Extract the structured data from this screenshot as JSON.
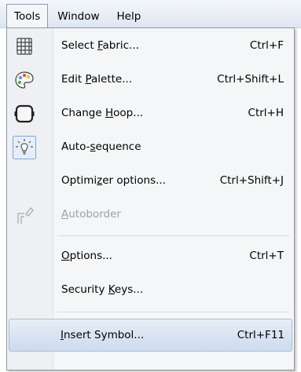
{
  "menubar": {
    "items": [
      {
        "label": "Tools"
      },
      {
        "label": "Window"
      },
      {
        "label": "Help"
      }
    ]
  },
  "menu": {
    "items": [
      {
        "pre": "Select ",
        "mn": "F",
        "post": "abric...",
        "shortcut": "Ctrl+F",
        "icon": "fabric-grid-icon"
      },
      {
        "pre": "Edit ",
        "mn": "P",
        "post": "alette...",
        "shortcut": "Ctrl+Shift+L",
        "icon": "palette-icon"
      },
      {
        "pre": "Change ",
        "mn": "H",
        "post": "oop...",
        "shortcut": "Ctrl+H",
        "icon": "hoop-icon"
      },
      {
        "pre": "Auto-",
        "mn": "s",
        "post": "equence",
        "shortcut": "",
        "icon": "auto-sequence-icon"
      },
      {
        "pre": "Optimi",
        "mn": "z",
        "post": "er options...",
        "shortcut": "Ctrl+Shift+J",
        "icon": ""
      },
      {
        "pre": "",
        "mn": "A",
        "post": "utoborder",
        "shortcut": "",
        "icon": "autoborder-icon"
      },
      {
        "pre": "",
        "mn": "O",
        "post": "ptions...",
        "shortcut": "Ctrl+T",
        "icon": ""
      },
      {
        "pre": "Security ",
        "mn": "K",
        "post": "eys...",
        "shortcut": "",
        "icon": ""
      },
      {
        "pre": "",
        "mn": "I",
        "post": "nsert Symbol...",
        "shortcut": "Ctrl+F11",
        "icon": ""
      }
    ]
  },
  "colors": {
    "highlight": "#cddbee",
    "disabled_text": "#9aa1a8",
    "menu_bg": "#f5f6f7"
  }
}
